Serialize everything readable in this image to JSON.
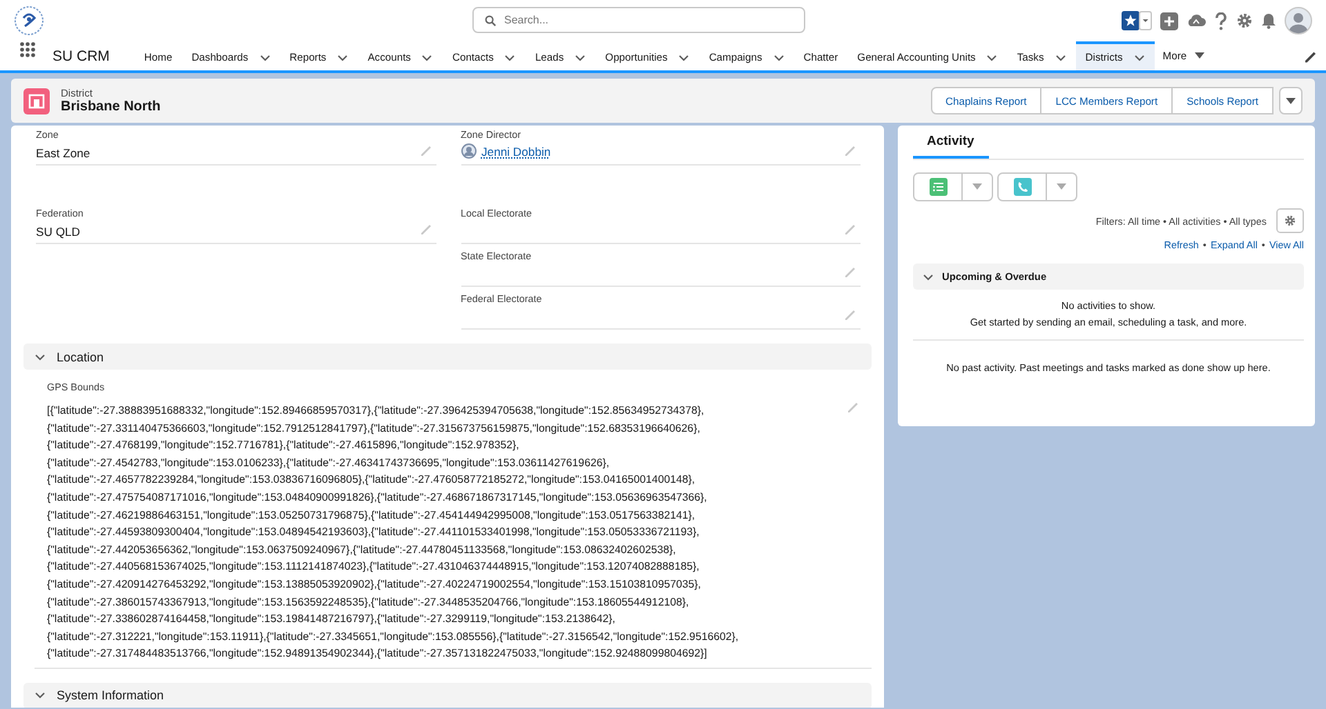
{
  "header": {
    "search": {
      "placeholder": "Search..."
    }
  },
  "nav": {
    "app_name": "SU CRM",
    "items": [
      {
        "label": "Home",
        "dropdown": false,
        "selected": false
      },
      {
        "label": "Dashboards",
        "dropdown": true,
        "selected": false
      },
      {
        "label": "Reports",
        "dropdown": true,
        "selected": false
      },
      {
        "label": "Accounts",
        "dropdown": true,
        "selected": false
      },
      {
        "label": "Contacts",
        "dropdown": true,
        "selected": false
      },
      {
        "label": "Leads",
        "dropdown": true,
        "selected": false
      },
      {
        "label": "Opportunities",
        "dropdown": true,
        "selected": false
      },
      {
        "label": "Campaigns",
        "dropdown": true,
        "selected": false
      },
      {
        "label": "Chatter",
        "dropdown": false,
        "selected": false
      },
      {
        "label": "General Accounting Units",
        "dropdown": true,
        "selected": false
      },
      {
        "label": "Tasks",
        "dropdown": true,
        "selected": false
      },
      {
        "label": "Districts",
        "dropdown": true,
        "selected": true
      }
    ],
    "more": "More"
  },
  "record": {
    "object": "District",
    "title": "Brisbane North",
    "actions": [
      "Chaplains Report",
      "LCC Members Report",
      "Schools Report"
    ]
  },
  "details": {
    "rows": [
      {
        "left": {
          "label": "Zone",
          "value": "East Zone",
          "kind": "text"
        },
        "right": {
          "label": "Zone Director",
          "value": "Jenni Dobbin",
          "kind": "lookup"
        }
      },
      {
        "left": {
          "label": "Federation",
          "value": "SU QLD",
          "kind": "text"
        },
        "right": {
          "label": "Local Electorate",
          "kind": "text"
        }
      },
      {
        "right": {
          "label": "State Electorate",
          "kind": "text"
        }
      },
      {
        "right": {
          "label": "Federal Electorate",
          "kind": "text"
        }
      }
    ],
    "sections": [
      {
        "title": "Location",
        "expanded": true,
        "fields": [
          {
            "label": "GPS Bounds",
            "lines": [
              "[{\"latitude\":-27.38883951688332,\"longitude\":152.89466859570317},{\"latitude\":-27.396425394705638,\"longitude\":152.85634952734378},",
              "{\"latitude\":-27.331140475366603,\"longitude\":152.7912512841797},{\"latitude\":-27.315673756159875,\"longitude\":152.68353196640626},",
              "{\"latitude\":-27.4768199,\"longitude\":152.7716781},{\"latitude\":-27.4615896,\"longitude\":152.978352},",
              "{\"latitude\":-27.4542783,\"longitude\":153.0106233},{\"latitude\":-27.46341743736695,\"longitude\":153.03611427619626},",
              "{\"latitude\":-27.4657782239284,\"longitude\":153.03836716096805},{\"latitude\":-27.476058772185272,\"longitude\":153.04165001400148},",
              "{\"latitude\":-27.475754087171016,\"longitude\":153.04840900991826},{\"latitude\":-27.468671867317145,\"longitude\":153.05636963547366},",
              "{\"latitude\":-27.46219886463151,\"longitude\":153.05250731796875},{\"latitude\":-27.454144942995008,\"longitude\":153.0517563382141},",
              "{\"latitude\":-27.44593809300404,\"longitude\":153.04894542193603},{\"latitude\":-27.441101533401998,\"longitude\":153.05053336721193},",
              "{\"latitude\":-27.442053656362,\"longitude\":153.0637509240967},{\"latitude\":-27.44780451133568,\"longitude\":153.08632402602538},",
              "{\"latitude\":-27.440568153674025,\"longitude\":153.1112141874023},{\"latitude\":-27.431046374448915,\"longitude\":153.12074082888185},",
              "{\"latitude\":-27.420914276453292,\"longitude\":153.13885053920902},{\"latitude\":-27.40224719002554,\"longitude\":153.15103810957035},",
              "{\"latitude\":-27.386015743367913,\"longitude\":153.1563592248535},{\"latitude\":-27.3448535204766,\"longitude\":153.18605544912108},",
              "{\"latitude\":-27.338602874164458,\"longitude\":153.19841487216797},{\"latitude\":-27.3299119,\"longitude\":153.2138642},",
              "{\"latitude\":-27.312221,\"longitude\":153.11911},{\"latitude\":-27.3345651,\"longitude\":153.085556},{\"latitude\":-27.3156542,\"longitude\":152.9516602},",
              "{\"latitude\":-27.317484483513766,\"longitude\":152.94891354902344},{\"latitude\":-27.357131822475033,\"longitude\":152.92488099804692}]"
            ]
          }
        ]
      },
      {
        "title": "System Information",
        "expanded": true
      }
    ]
  },
  "activity": {
    "tabs": [
      {
        "label": "Activity",
        "selected": true
      }
    ],
    "filters": "Filters: All time • All activities • All types",
    "links": [
      "Refresh",
      "Expand All",
      "View All"
    ],
    "link_separator": "•",
    "upcoming": {
      "title": "Upcoming & Overdue",
      "expanded": true,
      "empty_title": "No activities to show.",
      "empty_text": "Get started by sending an email, scheduling a task, and more."
    },
    "past_text": "No past activity. Past meetings and tasks marked as done show up here."
  }
}
